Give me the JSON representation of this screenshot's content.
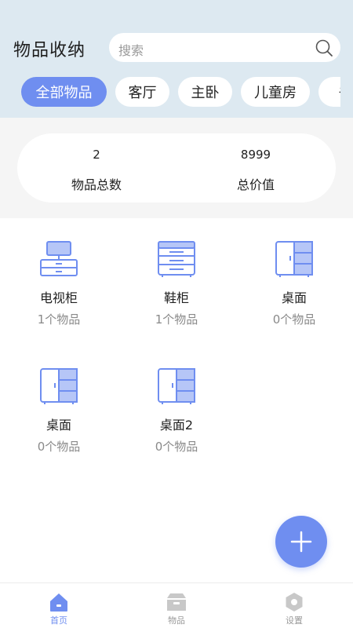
{
  "header": {
    "title": "物品收纳"
  },
  "search": {
    "placeholder": "搜索"
  },
  "tabs": [
    {
      "label": "全部物品",
      "active": true
    },
    {
      "label": "客厅",
      "active": false
    },
    {
      "label": "主卧",
      "active": false
    },
    {
      "label": "儿童房",
      "active": false
    },
    {
      "label": "书",
      "active": false
    }
  ],
  "stats": [
    {
      "value": "2",
      "label": "物品总数"
    },
    {
      "value": "8999",
      "label": "总价值"
    }
  ],
  "furniture": [
    {
      "name": "电视柜",
      "count": "1个物品",
      "icon": "tv-cabinet-icon"
    },
    {
      "name": "鞋柜",
      "count": "1个物品",
      "icon": "shoe-cabinet-icon"
    },
    {
      "name": "桌面",
      "count": "0个物品",
      "icon": "wardrobe-icon"
    },
    {
      "name": "桌面",
      "count": "0个物品",
      "icon": "wardrobe-icon"
    },
    {
      "name": "桌面2",
      "count": "0个物品",
      "icon": "wardrobe-icon"
    }
  ],
  "fab": {
    "icon": "plus-icon"
  },
  "nav": [
    {
      "label": "首页",
      "icon": "home-icon",
      "active": true
    },
    {
      "label": "物品",
      "icon": "box-icon",
      "active": false
    },
    {
      "label": "设置",
      "icon": "settings-icon",
      "active": false
    }
  ],
  "colors": {
    "accent": "#6f8ef0",
    "header_bg": "#dde9f1",
    "inactive": "#c8c8c8"
  }
}
